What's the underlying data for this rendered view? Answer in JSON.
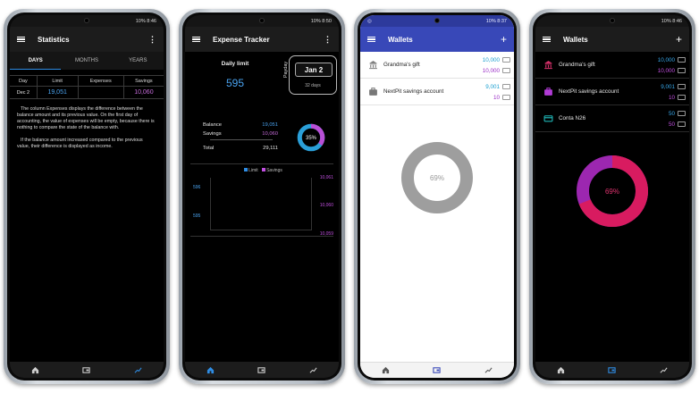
{
  "phones": {
    "stats": {
      "time": "10% 8:46",
      "title": "Statistics",
      "tabs": [
        "DAYS",
        "MONTHS",
        "YEARS"
      ],
      "table": {
        "headers": [
          "Day",
          "Limit",
          "Expenses",
          "Savings"
        ],
        "row": [
          "Dec 2",
          "19,051",
          "",
          "10,060"
        ]
      },
      "note1": "The column Expenses displays the difference between the balance amount and its previous value. On the first day of accounting, the value of expenses will be empty, because there is nothing to compare the state of the balance with.",
      "note2": "If the balance amount increased compared to the previous value, their difference is displayed as income."
    },
    "tracker": {
      "time": "10% 8:50",
      "title": "Expense Tracker",
      "daily_limit_label": "Daily limit",
      "daily_limit_value": "595",
      "payday_label": "Payday",
      "payday_date": "Jan 2",
      "payday_days": "32 days",
      "balance_label": "Balance",
      "balance_value": "19,051",
      "savings_label": "Savings",
      "savings_value": "10,060",
      "total_label": "Total",
      "total_value": "29,111",
      "donut_percent_label": "35%",
      "donut_fraction": 0.35,
      "legend_limit": "Limit",
      "legend_savings": "Savings",
      "y_left": [
        "596",
        "595"
      ],
      "y_right": [
        "10,061",
        "10,060",
        "10,059"
      ]
    },
    "wallets_light": {
      "time": "10% 8:37",
      "title": "Wallets",
      "add": "+",
      "items": [
        {
          "name": "Grandma's gift",
          "v1": "10,000",
          "v2": "10,000"
        },
        {
          "name": "NextPit savings account",
          "v1": "9,001",
          "v2": "10"
        }
      ],
      "donut_label": "69%"
    },
    "wallets_dark": {
      "time": "10% 8:46",
      "title": "Wallets",
      "add": "+",
      "items": [
        {
          "name": "Grandma's gift",
          "v1": "10,000",
          "v2": "10,000"
        },
        {
          "name": "NextPit savings account",
          "v1": "9,001",
          "v2": "10"
        },
        {
          "name": "Conta N26",
          "v1": "50",
          "v2": "50"
        }
      ],
      "donut_label": "69%",
      "donut_fraction": 0.69
    }
  },
  "colors": {
    "accent_blue": "#2f8de4",
    "purple": "#c14fe0",
    "donut_pink": "#d81b60",
    "donut_gray": "#9e9e9e"
  },
  "icons": [
    "menu-icon",
    "more-icon",
    "home-icon",
    "wallet-icon",
    "chart-icon",
    "bank-icon",
    "briefcase-icon",
    "card-icon"
  ]
}
